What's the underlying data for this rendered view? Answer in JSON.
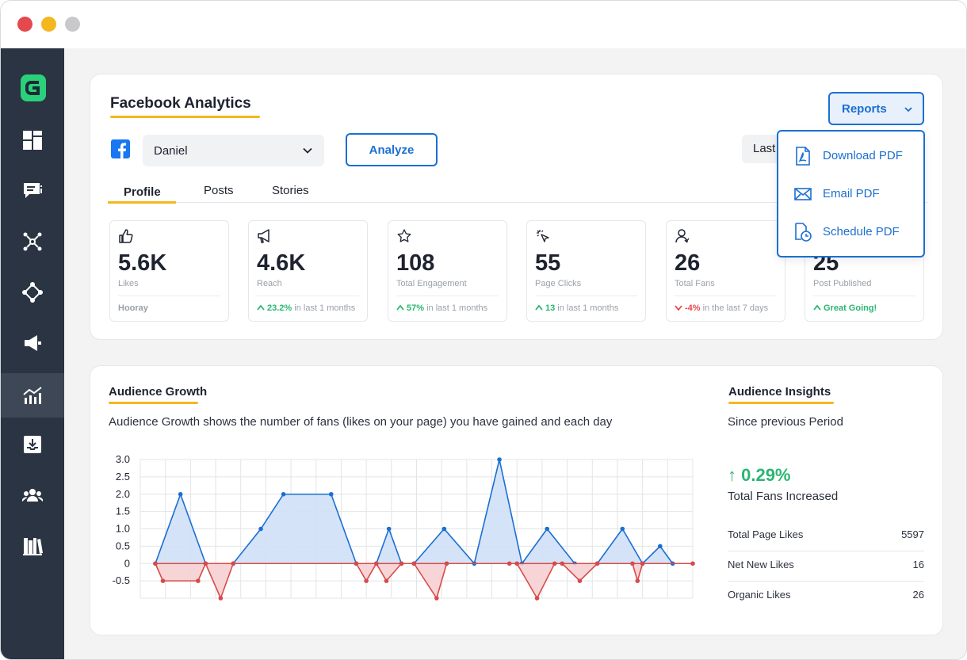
{
  "app": {
    "title": "Facebook Analytics",
    "account_select": "Daniel",
    "analyze_label": "Analyze",
    "period_label": "Last",
    "reports_label": "Reports"
  },
  "tabs": [
    {
      "label": "Profile",
      "active": true
    },
    {
      "label": "Posts",
      "active": false
    },
    {
      "label": "Stories",
      "active": false
    }
  ],
  "stats": [
    {
      "icon": "thumbs-up-icon",
      "value": "5.6K",
      "label": "Likes",
      "foot": "Hooray",
      "foot_type": "text-green"
    },
    {
      "icon": "megaphone-icon",
      "value": "4.6K",
      "label": "Reach",
      "foot_value": "23.2%",
      "foot_rest": " in last 1 months",
      "foot_type": "up"
    },
    {
      "icon": "star-icon",
      "value": "108",
      "label": "Total Engagement",
      "foot_value": "57%",
      "foot_rest": " in last 1 months",
      "foot_type": "up"
    },
    {
      "icon": "cursor-click-icon",
      "value": "55",
      "label": "Page Clicks",
      "foot_value": "13",
      "foot_rest": " in last 1 months",
      "foot_type": "up"
    },
    {
      "icon": "user-icon",
      "value": "26",
      "label": "Total Fans",
      "foot_value": "-4%",
      "foot_rest": " in the last 7 days",
      "foot_type": "down"
    },
    {
      "icon": "document-icon",
      "value": "25",
      "label": "Post Published",
      "foot_value": "Great Going!",
      "foot_rest": "",
      "foot_type": "up"
    }
  ],
  "reports_menu": [
    {
      "icon": "pdf-file-icon",
      "label": "Download PDF"
    },
    {
      "icon": "envelope-icon",
      "label": "Email PDF"
    },
    {
      "icon": "schedule-pdf-icon",
      "label": "Schedule PDF"
    }
  ],
  "audience_growth": {
    "title": "Audience Growth",
    "description": "Audience Growth shows the number of fans (likes on your page) you have gained and each day"
  },
  "audience_insights": {
    "title": "Audience Insights",
    "subtitle": "Since previous Period",
    "change": "↑ 0.29%",
    "change_label": "Total Fans Increased",
    "rows": [
      {
        "label": "Total Page Likes",
        "value": "5597"
      },
      {
        "label": "Net New Likes",
        "value": "16"
      },
      {
        "label": "Organic Likes",
        "value": "26"
      }
    ]
  },
  "colors": {
    "accent_blue": "#1b6fd1",
    "gain_line": "#1b6fd1",
    "loss_line": "#d84a4a",
    "gain_fill": "#cfe0f7",
    "loss_fill": "#f6d0d2",
    "underline_yellow": "#f5b71f",
    "positive_green": "#2bb673",
    "sidebar_bg": "#2b3442"
  },
  "chart_data": {
    "type": "area",
    "ylim": [
      -1,
      3
    ],
    "yticks": [
      "3.0",
      "2.5",
      "2.0",
      "1.5",
      "1.0",
      "0.5",
      "0",
      "-0.5"
    ],
    "series": [
      {
        "values_by_x": [
          [
            0.6,
            0
          ],
          [
            1.6,
            2
          ],
          [
            2.6,
            0
          ],
          [
            3.7,
            0
          ],
          [
            4.8,
            1
          ],
          [
            5.7,
            2
          ],
          [
            7.6,
            2
          ],
          [
            8.6,
            0
          ],
          [
            9.4,
            0
          ],
          [
            9.9,
            1
          ],
          [
            10.4,
            0
          ],
          [
            10.9,
            0
          ],
          [
            12.1,
            1
          ],
          [
            13.3,
            0
          ],
          [
            14.3,
            3
          ],
          [
            15.2,
            0
          ],
          [
            16.2,
            1
          ],
          [
            17.3,
            0
          ],
          [
            18.2,
            0
          ],
          [
            19.2,
            1
          ],
          [
            20.0,
            0
          ],
          [
            20.7,
            0.5
          ],
          [
            21.2,
            0
          ]
        ]
      },
      {
        "values_by_x": [
          [
            0.6,
            0
          ],
          [
            0.9,
            -0.5
          ],
          [
            2.3,
            -0.5
          ],
          [
            2.6,
            0
          ],
          [
            3.2,
            -1
          ],
          [
            3.7,
            0
          ],
          [
            8.6,
            0
          ],
          [
            9.0,
            -0.5
          ],
          [
            9.4,
            0
          ],
          [
            9.8,
            -0.5
          ],
          [
            10.4,
            0
          ],
          [
            10.9,
            0
          ],
          [
            11.8,
            -1
          ],
          [
            12.2,
            0
          ],
          [
            14.7,
            0
          ],
          [
            15.0,
            0
          ],
          [
            15.8,
            -1
          ],
          [
            16.5,
            0
          ],
          [
            16.8,
            0
          ],
          [
            17.5,
            -0.5
          ],
          [
            18.2,
            0
          ],
          [
            19.6,
            0
          ],
          [
            19.8,
            -0.5
          ],
          [
            20.0,
            0
          ],
          [
            22.0,
            0
          ]
        ]
      }
    ]
  }
}
